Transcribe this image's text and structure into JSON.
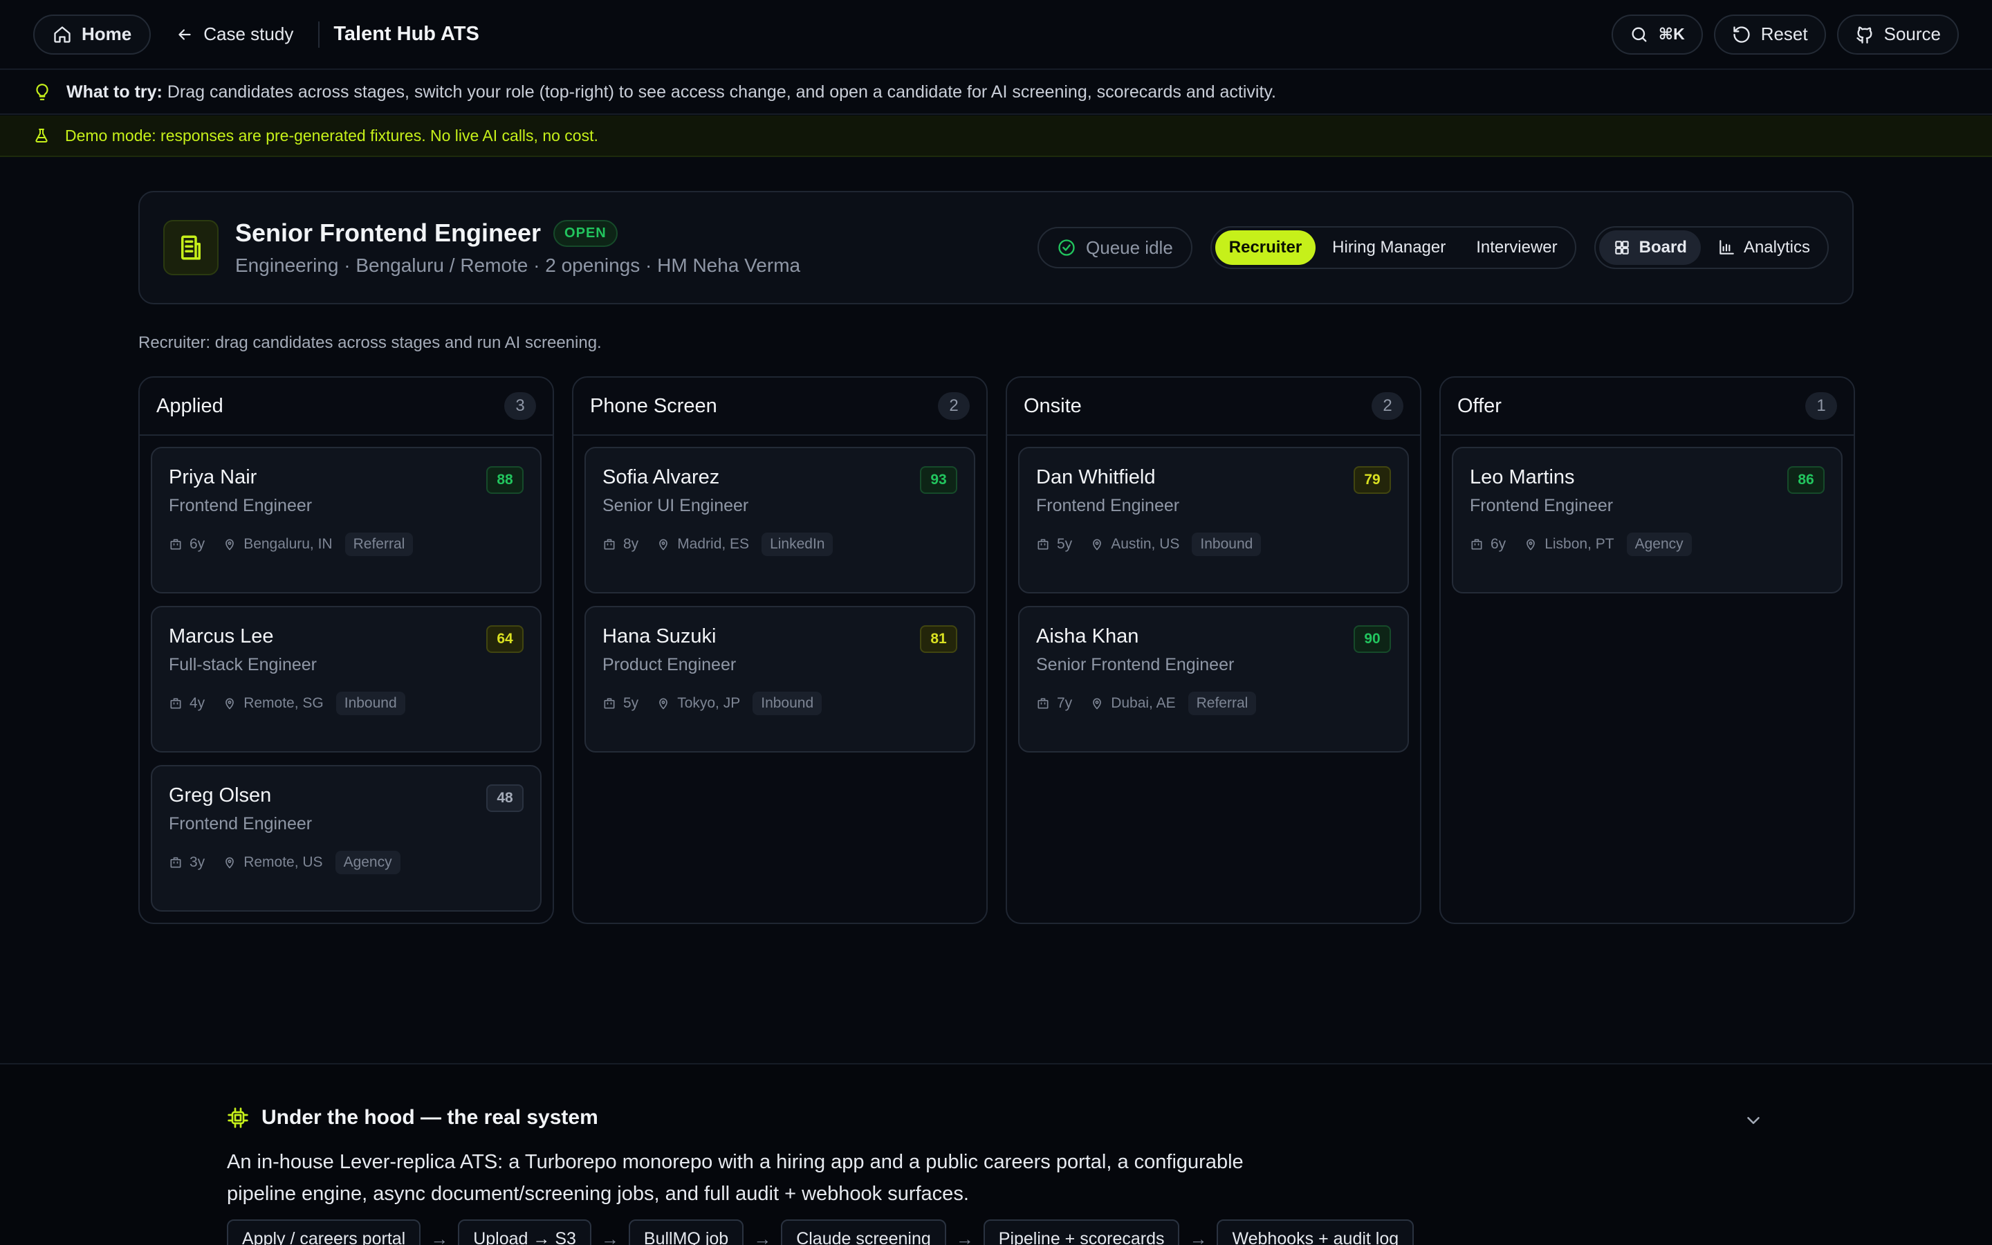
{
  "topbar": {
    "home_label": "Home",
    "case_study_label": "Case study",
    "app_title": "Talent Hub ATS",
    "search_shortcut": "⌘K",
    "reset_label": "Reset",
    "source_label": "Source"
  },
  "hint": {
    "prefix": "What to try:",
    "text": " Drag candidates across stages, switch your role (top-right) to see access change, and open a candidate for AI screening, scorecards and activity."
  },
  "demo_notice": "Demo mode: responses are pre-generated fixtures. No live AI calls, no cost.",
  "job": {
    "title": "Senior Frontend Engineer",
    "status": "OPEN",
    "meta": "Engineering · Bengaluru / Remote · 2 openings · HM Neha Verma",
    "queue_status": "Queue idle",
    "roles": [
      "Recruiter",
      "Hiring Manager",
      "Interviewer"
    ],
    "active_role": "Recruiter",
    "views": [
      "Board",
      "Analytics"
    ],
    "active_view": "Board"
  },
  "role_note": "Recruiter: drag candidates across stages and run AI screening.",
  "columns": [
    {
      "title": "Applied",
      "count": "3",
      "cards": [
        {
          "name": "Priya Nair",
          "role": "Frontend Engineer",
          "years": "6y",
          "location": "Bengaluru, IN",
          "source": "Referral",
          "score": "88",
          "tier": "high"
        },
        {
          "name": "Marcus Lee",
          "role": "Full-stack Engineer",
          "years": "4y",
          "location": "Remote, SG",
          "source": "Inbound",
          "score": "64",
          "tier": "mid"
        },
        {
          "name": "Greg Olsen",
          "role": "Frontend Engineer",
          "years": "3y",
          "location": "Remote, US",
          "source": "Agency",
          "score": "48",
          "tier": "low"
        }
      ]
    },
    {
      "title": "Phone Screen",
      "count": "2",
      "cards": [
        {
          "name": "Sofia Alvarez",
          "role": "Senior UI Engineer",
          "years": "8y",
          "location": "Madrid, ES",
          "source": "LinkedIn",
          "score": "93",
          "tier": "high"
        },
        {
          "name": "Hana Suzuki",
          "role": "Product Engineer",
          "years": "5y",
          "location": "Tokyo, JP",
          "source": "Inbound",
          "score": "81",
          "tier": "mid"
        }
      ]
    },
    {
      "title": "Onsite",
      "count": "2",
      "cards": [
        {
          "name": "Dan Whitfield",
          "role": "Frontend Engineer",
          "years": "5y",
          "location": "Austin, US",
          "source": "Inbound",
          "score": "79",
          "tier": "mid"
        },
        {
          "name": "Aisha Khan",
          "role": "Senior Frontend Engineer",
          "years": "7y",
          "location": "Dubai, AE",
          "source": "Referral",
          "score": "90",
          "tier": "high"
        }
      ]
    },
    {
      "title": "Offer",
      "count": "1",
      "cards": [
        {
          "name": "Leo Martins",
          "role": "Frontend Engineer",
          "years": "6y",
          "location": "Lisbon, PT",
          "source": "Agency",
          "score": "86",
          "tier": "high"
        }
      ]
    }
  ],
  "hood": {
    "title": "Under the hood — the real system",
    "description": "An in-house Lever-replica ATS: a Turborepo monorepo with a hiring app and a public careers portal, a configurable pipeline engine, async document/screening jobs, and full audit + webhook surfaces.",
    "flow": [
      "Apply / careers portal",
      "Upload → S3",
      "BullMQ job",
      "Claude screening",
      "Pipeline + scorecards",
      "Webhooks + audit log"
    ]
  },
  "colors": {
    "accent": "#c6f01a",
    "score_high": "#22c55e",
    "score_mid": "#d9e021",
    "score_low": "#a4abb8"
  }
}
